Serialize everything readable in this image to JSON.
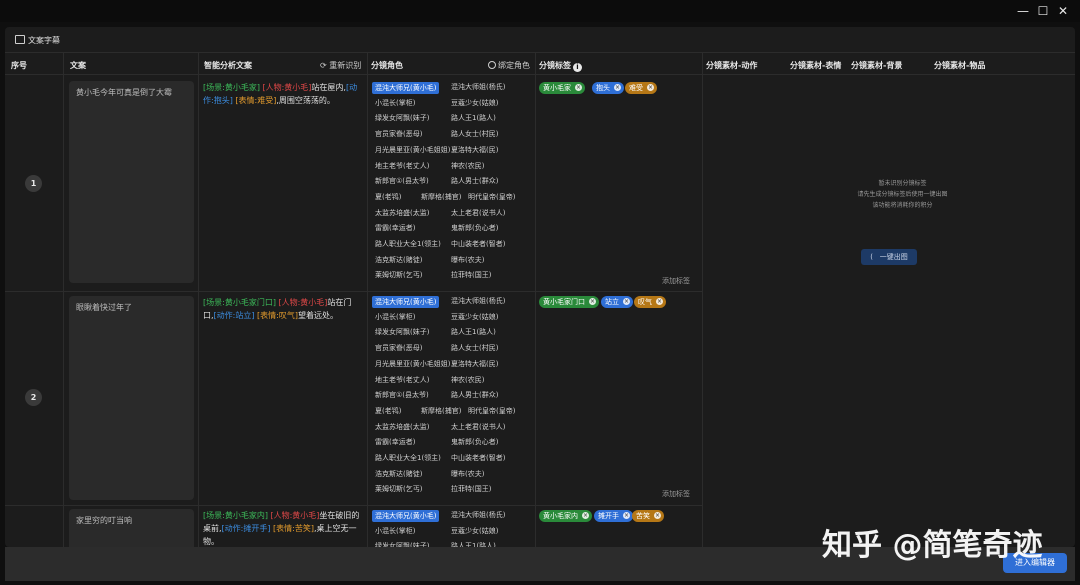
{
  "window": {
    "minimize": "—",
    "maximize": "☐",
    "close": "✕"
  },
  "panel": {
    "title": "文案字幕"
  },
  "columns": {
    "index": "序号",
    "text": "文案",
    "analysis": "智能分析文案",
    "reanalyze": "重新识别",
    "roles": "分镜角色",
    "bind_role": "绑定角色",
    "tags": "分镜标签",
    "action": "分镜素材-动作",
    "expression": "分镜素材-表情",
    "background": "分镜素材-背景",
    "object": "分镜素材-物品"
  },
  "roles_list": [
    [
      "混沌大师兄(黄小毛)",
      "混沌大师姐(杨氏)"
    ],
    [
      "小混长(掌柜)",
      "豆蔻少女(姑娘)"
    ],
    [
      "绿发女阿飘(妹子)",
      "路人王1(路人)"
    ],
    [
      "官员家眷(恶母)",
      "路人女士(村民)"
    ],
    [
      "月光晨里亚(黄小毛姐姐)",
      "夏洛特大福(民)"
    ],
    [
      "地主老爷(老丈人)",
      "神农(农民)"
    ],
    [
      "新郎官①(县太爷)",
      "路人男士(群众)"
    ],
    [
      "夏(老鸨)",
      "斯摩格(捕官)",
      "明代皇帝(皇帝)"
    ],
    [
      "太监苏培盛(太监)",
      "太上老君(说书人)"
    ],
    [
      "雷霸(幸运者)",
      "鬼新郎(负心者)"
    ],
    [
      "路人职业大全1(领主)",
      "中山装老者(智者)"
    ],
    [
      "浩克斯达(赌徒)",
      "曝布(农夫)"
    ],
    [
      "莱姆切斯(乞丐)",
      "拉菲特(国王)"
    ]
  ],
  "rows": [
    {
      "index": "1",
      "text": "黄小毛今年可真是倒了大霉",
      "analysis": {
        "scene": "[场景:黄小毛家]",
        "person": "[人物:黄小毛]",
        "mid": "站在屋内,",
        "action": "[动作:抱头]",
        "expr": "[表情:难受]",
        "rest": ",周围空荡荡的。"
      },
      "tags": [
        "黄小毛家",
        "抱头",
        "难受"
      ],
      "add_tag": "添加标签"
    },
    {
      "index": "2",
      "text": "眼瞅着快过年了",
      "analysis": {
        "scene": "[场景:黄小毛家门口]",
        "person": "[人物:黄小毛]",
        "mid": "站在门口,",
        "action": "[动作:站立]",
        "expr": "[表情:叹气]",
        "rest": "望着远处。"
      },
      "tags": [
        "黄小毛家门口",
        "站立",
        "叹气"
      ],
      "add_tag": "添加标签"
    },
    {
      "index": "",
      "text": "家里穷的叮当响",
      "analysis": {
        "scene": "[场景:黄小毛家内]",
        "person": "[人物:黄小毛]",
        "mid": "坐在破旧的桌前,",
        "action": "[动作:摊开手]",
        "expr": "[表情:苦笑]",
        "rest": ",桌上空无一物。"
      },
      "tags": [
        "黄小毛家内",
        "摊开手",
        "苦笑"
      ],
      "add_tag": ""
    }
  ],
  "empty_state": {
    "line1": "暂未识别分镜标签",
    "line2": "请先生成分镜标签后使用一键出图",
    "line3": "该功能将消耗你的积分",
    "button": "一键出图"
  },
  "footer": {
    "editor_button": "进入编辑器"
  },
  "watermark": "知乎 @简笔奇迹",
  "colors": {
    "selected_role": "#2f6fd6",
    "tag_green": "#2a8a3a",
    "tag_blue": "#2f6fd6",
    "tag_orange": "#b57716"
  }
}
